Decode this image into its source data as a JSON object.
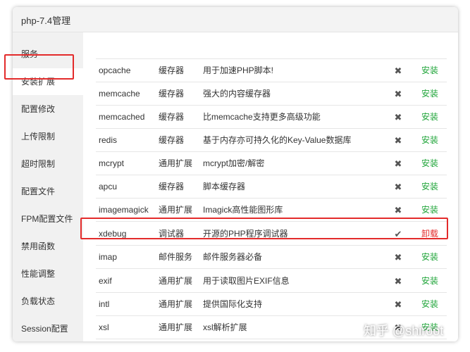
{
  "window": {
    "title": "php-7.4管理"
  },
  "sidebar": {
    "items": [
      {
        "label": "服务"
      },
      {
        "label": "安装扩展"
      },
      {
        "label": "配置修改"
      },
      {
        "label": "上传限制"
      },
      {
        "label": "超时限制"
      },
      {
        "label": "配置文件"
      },
      {
        "label": "FPM配置文件"
      },
      {
        "label": "禁用函数"
      },
      {
        "label": "性能调整"
      },
      {
        "label": "负载状态"
      },
      {
        "label": "Session配置"
      }
    ],
    "active_index": 1
  },
  "extensions": {
    "rows": [
      {
        "name": "opcache",
        "type": "缓存器",
        "desc": "用于加速PHP脚本!",
        "installed": false,
        "status_icon": "cross-icon",
        "action": "安装"
      },
      {
        "name": "memcache",
        "type": "缓存器",
        "desc": "强大的内容缓存器",
        "installed": false,
        "status_icon": "cross-icon",
        "action": "安装"
      },
      {
        "name": "memcached",
        "type": "缓存器",
        "desc": "比memcache支持更多高级功能",
        "installed": false,
        "status_icon": "cross-icon",
        "action": "安装"
      },
      {
        "name": "redis",
        "type": "缓存器",
        "desc": "基于内存亦可持久化的Key-Value数据库",
        "installed": false,
        "status_icon": "cross-icon",
        "action": "安装"
      },
      {
        "name": "mcrypt",
        "type": "通用扩展",
        "desc": "mcrypt加密/解密",
        "installed": false,
        "status_icon": "cross-icon",
        "action": "安装"
      },
      {
        "name": "apcu",
        "type": "缓存器",
        "desc": "脚本缓存器",
        "installed": false,
        "status_icon": "cross-icon",
        "action": "安装"
      },
      {
        "name": "imagemagick",
        "type": "通用扩展",
        "desc": "Imagick高性能图形库",
        "installed": false,
        "status_icon": "cross-icon",
        "action": "安装"
      },
      {
        "name": "xdebug",
        "type": "调试器",
        "desc": "开源的PHP程序调试器",
        "installed": true,
        "status_icon": "check-icon",
        "action": "卸载"
      },
      {
        "name": "imap",
        "type": "邮件服务",
        "desc": "邮件服务器必备",
        "installed": false,
        "status_icon": "cross-icon",
        "action": "安装"
      },
      {
        "name": "exif",
        "type": "通用扩展",
        "desc": "用于读取图片EXIF信息",
        "installed": false,
        "status_icon": "cross-icon",
        "action": "安装"
      },
      {
        "name": "intl",
        "type": "通用扩展",
        "desc": "提供国际化支持",
        "installed": false,
        "status_icon": "cross-icon",
        "action": "安装"
      },
      {
        "name": "xsl",
        "type": "通用扩展",
        "desc": "xsl解析扩展",
        "installed": false,
        "status_icon": "cross-icon",
        "action": "安装"
      }
    ]
  },
  "symbols": {
    "check": "✔",
    "cross": "✖"
  },
  "colors": {
    "install": "#20a53a",
    "uninstall": "#e32b2b",
    "highlight": "#e32b2b",
    "sidebar_bg": "#f1f1f1"
  },
  "watermark": "知乎 @shiroot"
}
